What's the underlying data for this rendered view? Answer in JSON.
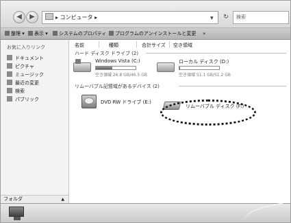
{
  "address_bar": {
    "path": "▸ コンピュータ ▸"
  },
  "search": {
    "placeholder": "検索"
  },
  "toolbar": {
    "organize": "整理 ▾",
    "views": "表示 ▾",
    "system_properties": "システムのプロパティ",
    "uninstall": "プログラムのアンインストールと変更",
    "more": "»"
  },
  "nav_pane": {
    "favorites_header": "お気に入りリンク",
    "items": [
      "ドキュメント",
      "ピクチャ",
      "ミュージック",
      "最近の変更",
      "検索",
      "パブリック"
    ],
    "folders_label": "フォルダ"
  },
  "columns": [
    "名前",
    "種類",
    "合計サイズ",
    "空き領域"
  ],
  "hard_disks": {
    "header": "ハード ディスク ドライブ (2)",
    "drives": [
      {
        "name": "Windows Vista (C:)",
        "free": "空き領域 26.8 GB/46.5 GB",
        "used_fraction": 0.42
      },
      {
        "name": "ローカル ディスク (D:)",
        "free": "空き領域 51.1 GB/51.2 GB",
        "used_fraction": 0.01
      }
    ]
  },
  "removable": {
    "header": "リムーバブル記憶域があるデバイス (2)",
    "devices": [
      {
        "name": "DVD RW ドライブ (E:)"
      },
      {
        "name": "リムーバブル ディスク (F:)"
      }
    ]
  }
}
